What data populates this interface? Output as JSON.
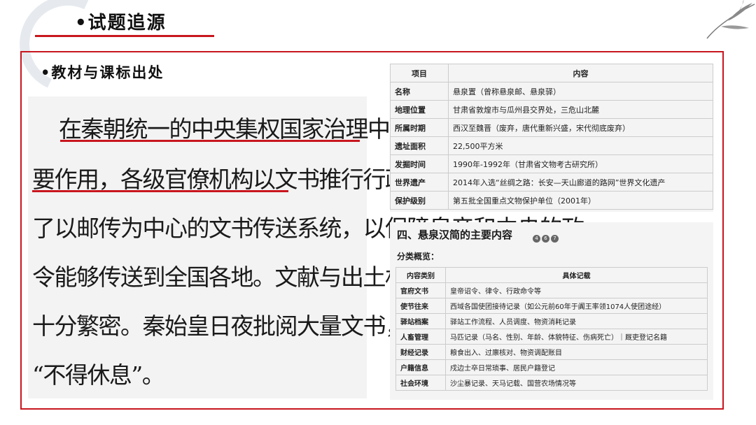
{
  "header": {
    "title": "•试题追源",
    "subtitle": "•教材与课标出处"
  },
  "textbook": {
    "lines": [
      "在秦朝统一的中央集权国家治理中，文书发挥着重",
      "要作用，各级官僚机构以文书推行行政管理。秦朝还建立",
      "了以邮传为中心的文书传送系统，以保障皇帝和中央的政",
      "令能够传送到全国各地。文献与出土材料均反映秦朝文书",
      "十分繁密。秦始皇日夜批阅大量文书，不达到一定的数量",
      "“不得休息”。"
    ]
  },
  "info_table": {
    "headers": [
      "项目",
      "内容"
    ],
    "rows": [
      [
        "名称",
        "悬泉置（曾称悬泉邮、悬泉驿）"
      ],
      [
        "地理位置",
        "甘肃省敦煌市与瓜州县交界处，三危山北麓"
      ],
      [
        "所属时期",
        "西汉至魏晋（废弃，唐代重新兴盛，宋代彻底废弃）"
      ],
      [
        "遗址面积",
        "22,500平方米"
      ],
      [
        "发掘时间",
        "1990年-1992年（甘肃省文物考古研究所）"
      ],
      [
        "世界遗产",
        "2014年入选“丝绸之路：长安—天山廊道的路网”世界文化遗产"
      ],
      [
        "保护级别",
        "第五批全国重点文物保护单位（2001年）"
      ]
    ]
  },
  "content_section": {
    "title": "四、悬泉汉简的主要内容",
    "refs": [
      "4",
      "6",
      "7"
    ],
    "overview_label": "分类概览：",
    "headers": [
      "内容类别",
      "具体记载"
    ],
    "rows": [
      [
        "官府文书",
        "皇帝诏令、律令、行政命令等"
      ],
      [
        "使节往来",
        "西域各国使团接待记录（如公元前60年于阗王率领1074人使团途经）"
      ],
      [
        "驿站档案",
        "驿站工作流程、人员调度、物资消耗记录"
      ],
      [
        "人畜管理",
        "马匹记录（马名、性别、年龄、体貌特征、伤病死亡）｜厩吏登记名籍"
      ],
      [
        "财经记录",
        "粮食出入、过廪核对、物资调配账目"
      ],
      [
        "户籍信息",
        "戍边士卒日常琐事、居民户籍登记"
      ],
      [
        "社会环境",
        "沙尘暴记录、天马记载、国营农场情况等"
      ]
    ]
  },
  "colors": {
    "accent": "#c8161e"
  }
}
